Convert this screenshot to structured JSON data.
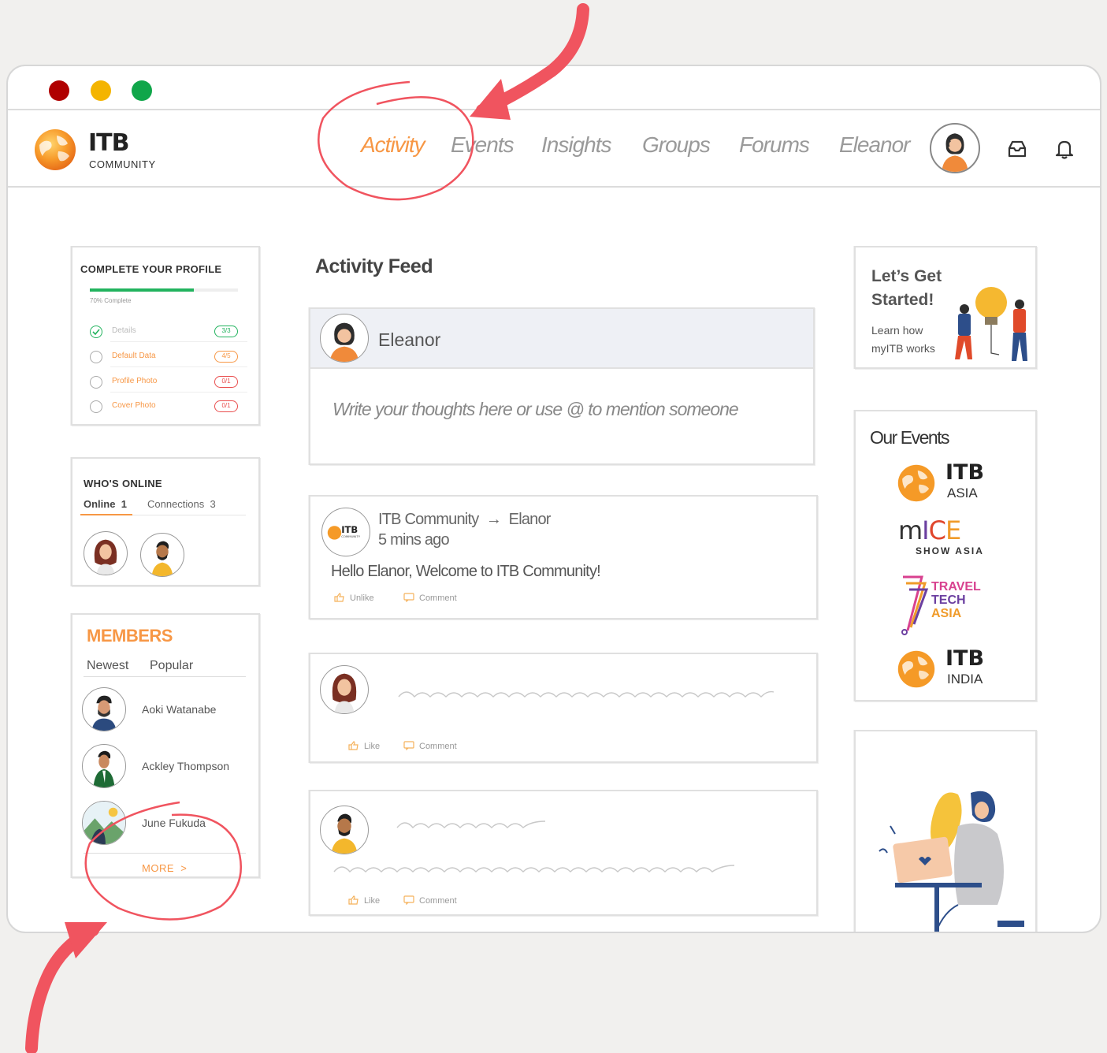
{
  "nav": {
    "brand": "ITB",
    "brand_sub": "COMMUNITY",
    "items": [
      "Activity",
      "Events",
      "Insights",
      "Groups",
      "Forums",
      "Eleanor"
    ],
    "active": "Activity"
  },
  "profile_card": {
    "title": "COMPLETE YOUR PROFILE",
    "progress_label": "70% Complete",
    "progress": 0.7,
    "rows": [
      {
        "label": "Details",
        "count": "3/3",
        "done": true
      },
      {
        "label": "Default Data",
        "count": "4/5",
        "done": false
      },
      {
        "label": "Profile Photo",
        "count": "0/1",
        "done": false
      },
      {
        "label": "Cover Photo",
        "count": "0/1",
        "done": false
      }
    ]
  },
  "online_card": {
    "title": "WHO'S ONLINE",
    "tab_online": "Online",
    "online_count": "1",
    "tab_connections": "Connections",
    "connections_count": "3"
  },
  "members_card": {
    "title": "MEMBERS",
    "tabs": [
      "Newest",
      "Popular"
    ],
    "members": [
      "Aoki Watanabe",
      "Ackley Thompson",
      "June Fukuda"
    ],
    "more": "MORE  >"
  },
  "feed": {
    "title": "Activity Feed",
    "composer_user": "Eleanor",
    "composer_placeholder": "Write your thoughts here or use @ to mention someone",
    "post1": {
      "from": "ITB Community",
      "to": "Elanor",
      "time": "5 mins ago",
      "text": "Hello Elanor, Welcome to ITB Community!",
      "unlike": "Unlike",
      "comment": "Comment"
    },
    "like": "Like",
    "comment": "Comment"
  },
  "right": {
    "started_title1": "Let’s Get",
    "started_title2": "Started!",
    "started_sub1": "Learn how",
    "started_sub2": "myITB works",
    "events_title": "Our Events",
    "events": [
      {
        "name": "ITB",
        "sub": "ASIA"
      },
      {
        "name": "mICE",
        "sub": "SHOW ASIA"
      },
      {
        "name": "TRAVEL TECH ASIA",
        "lines": [
          "TRAVEL",
          "TECH",
          "ASIA"
        ]
      },
      {
        "name": "ITB",
        "sub": "INDIA"
      }
    ]
  },
  "colors": {
    "accent": "#f79745",
    "annotation": "#f0545f",
    "red_dot": "#b00000",
    "yellow_dot": "#f4b400",
    "green_dot": "#10a64a"
  }
}
